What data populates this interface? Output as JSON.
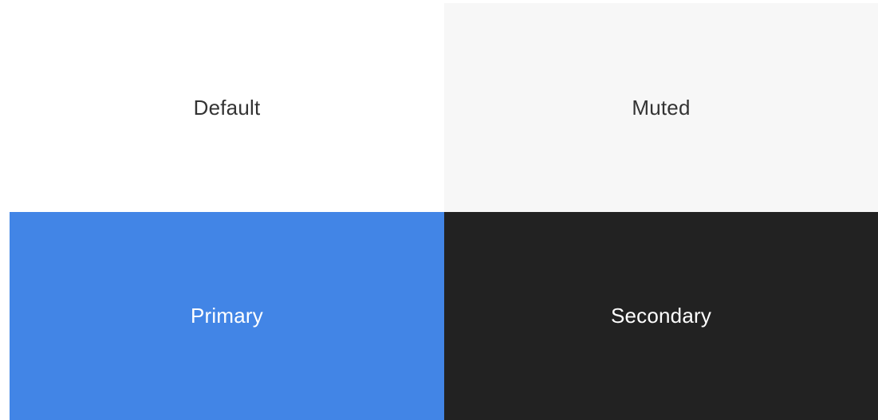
{
  "tiles": [
    {
      "label": "Default",
      "background": "#ffffff",
      "text_color": "#333333"
    },
    {
      "label": "Muted",
      "background": "#f7f7f7",
      "text_color": "#333333"
    },
    {
      "label": "Primary",
      "background": "#4285e6",
      "text_color": "#ffffff"
    },
    {
      "label": "Secondary",
      "background": "#222222",
      "text_color": "#ffffff"
    }
  ]
}
